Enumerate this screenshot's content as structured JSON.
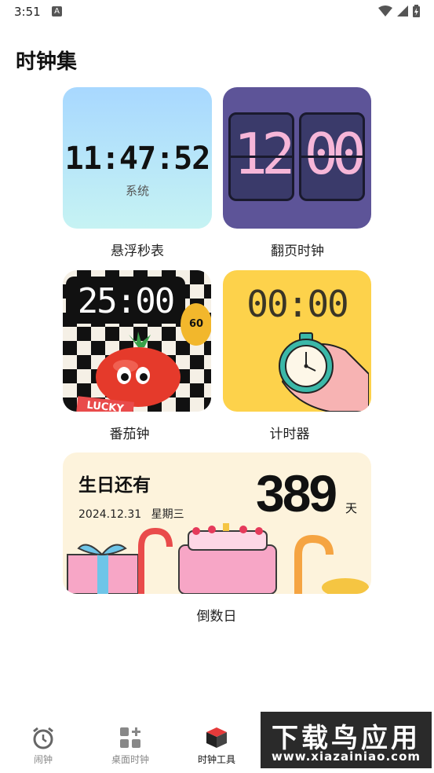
{
  "status_bar": {
    "time": "3:51",
    "notification_badge": "A"
  },
  "page_title": "时钟集",
  "cards": {
    "stopwatch": {
      "time": "11:47:52",
      "subtitle": "系统",
      "label": "悬浮秒表"
    },
    "flip_clock": {
      "hours": "12",
      "minutes": "00",
      "label": "翻页时钟"
    },
    "pomodoro": {
      "time": "25:00",
      "badge": "60",
      "sticker": "LUCKY",
      "label": "番茄钟"
    },
    "timer": {
      "time": "00:00",
      "label": "计时器"
    },
    "countdown": {
      "title": "生日还有",
      "date": "2024.12.31",
      "weekday": "星期三",
      "days": "389",
      "unit": "天",
      "label": "倒数日"
    }
  },
  "bottom_nav": {
    "items": [
      {
        "label": "闹钟",
        "icon": "alarm-clock-icon"
      },
      {
        "label": "桌面时钟",
        "icon": "widgets-icon"
      },
      {
        "label": "时钟工具",
        "icon": "cube-icon",
        "active": true
      }
    ]
  },
  "watermark": {
    "text": "下载鸟应用",
    "url": "www.xiazainiao.com"
  },
  "colors": {
    "stopwatch_bg": "#a8d8ff",
    "flip_bg": "#5d5498",
    "flip_digit": "#f6b6d8",
    "timer_bg": "#fdd24b",
    "countdown_bg": "#fdf3dc"
  }
}
